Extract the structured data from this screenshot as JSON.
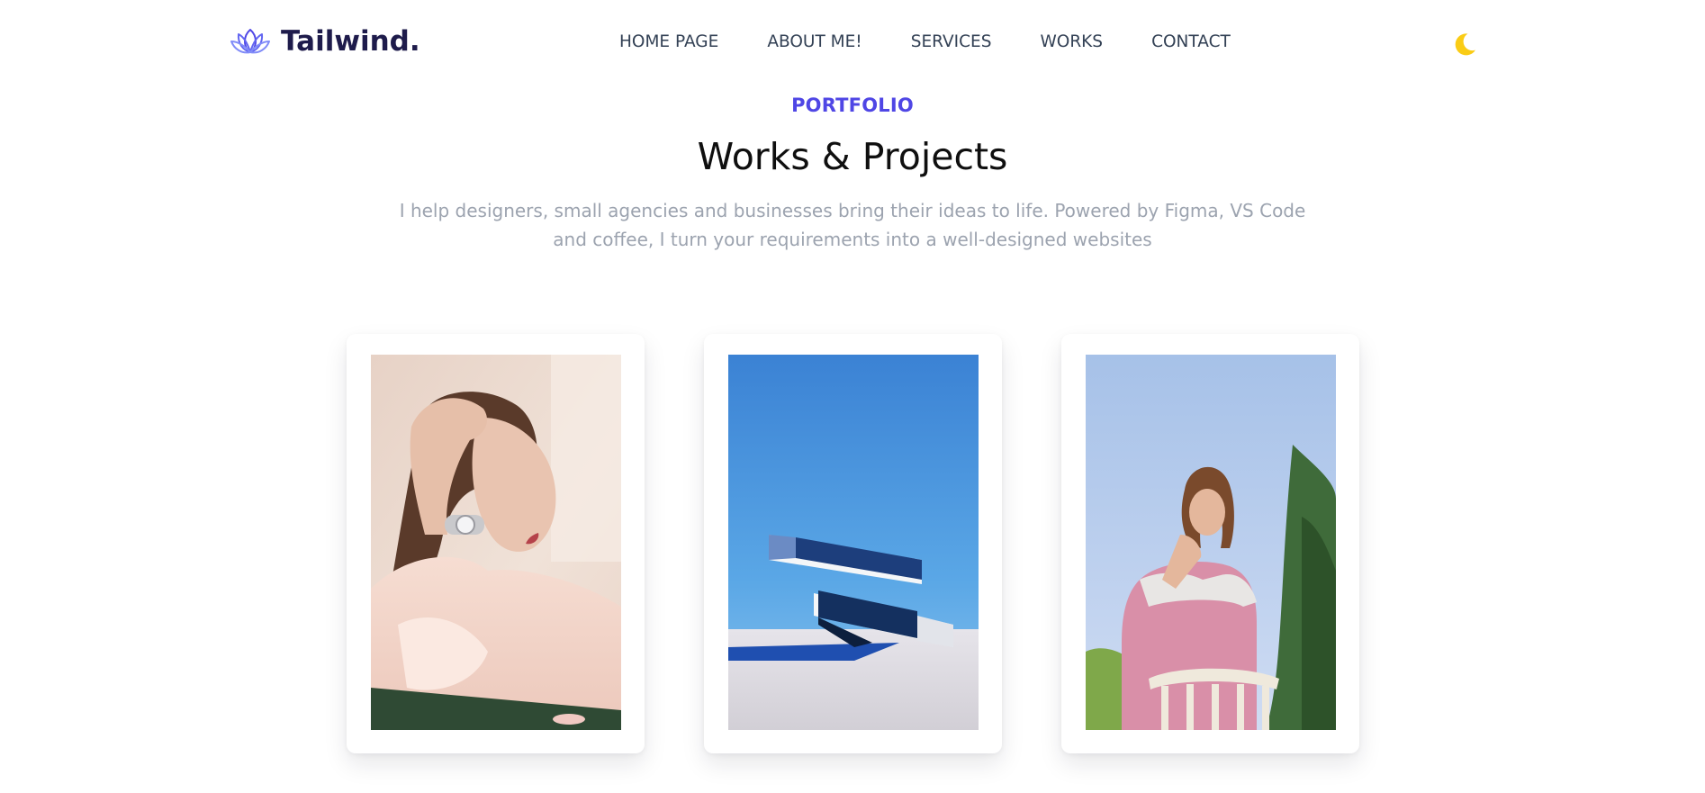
{
  "brand": {
    "name": "Tailwind.",
    "icon": "lotus-logo-icon",
    "color": "#1e1b4b"
  },
  "nav": {
    "items": [
      {
        "label": "HOME PAGE"
      },
      {
        "label": "ABOUT ME!"
      },
      {
        "label": "SERVICES"
      },
      {
        "label": "WORKS"
      },
      {
        "label": "CONTACT"
      }
    ]
  },
  "theme_toggle": {
    "icon": "moon-icon",
    "color": "#facc15"
  },
  "portfolio": {
    "eyebrow": "PORTFOLIO",
    "title": "Works & Projects",
    "subtitle": "I help designers, small agencies and businesses bring their ideas to life. Powered by Figma, VS Code and coffee, I turn your requirements into a well-designed websites",
    "accent_color": "#4f46e5",
    "projects": [
      {
        "image": "woman-with-watch-photo"
      },
      {
        "image": "architecture-blue-sky-photo"
      },
      {
        "image": "woman-on-chair-photo"
      }
    ]
  }
}
